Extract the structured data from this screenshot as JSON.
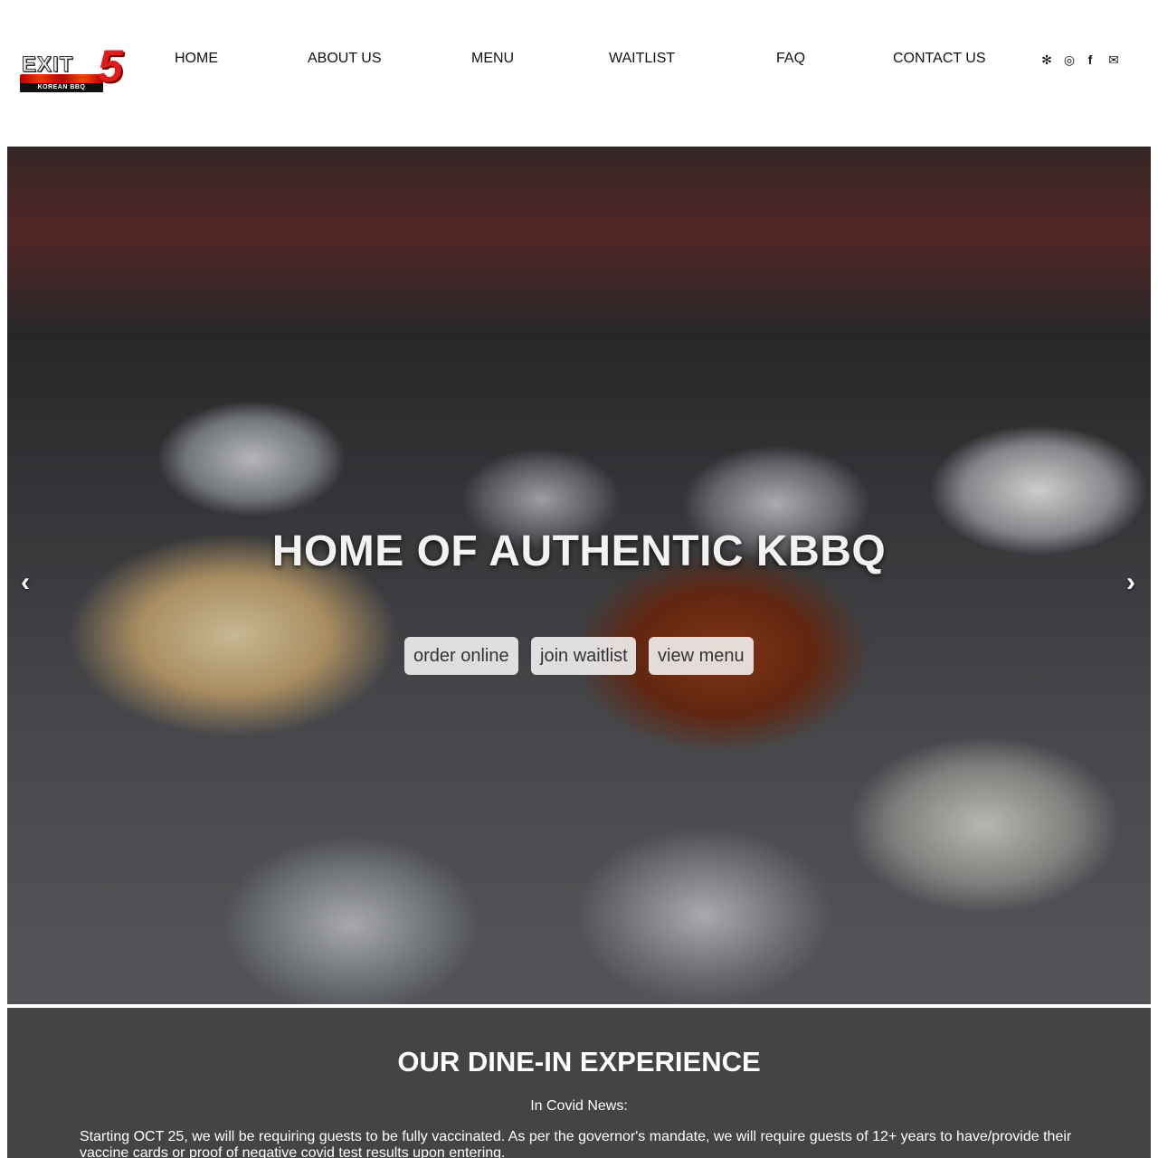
{
  "brand": {
    "logo_word": "EXIT",
    "logo_number": "5",
    "logo_subtitle": "KOREAN BBQ"
  },
  "nav": {
    "items": [
      {
        "label": "HOME"
      },
      {
        "label": "ABOUT US"
      },
      {
        "label": "MENU"
      },
      {
        "label": "WAITLIST"
      },
      {
        "label": "FAQ"
      },
      {
        "label": "CONTACT US"
      }
    ]
  },
  "social": {
    "icons": [
      "yelp-icon",
      "instagram-icon",
      "facebook-icon",
      "email-icon"
    ],
    "glyphs": {
      "yelp": "✻",
      "instagram": "◎",
      "facebook": "f",
      "email": "✉"
    }
  },
  "hero": {
    "title": "HOME OF AUTHENTIC KBBQ",
    "buttons": {
      "order": "order online",
      "waitlist": "join waitlist",
      "menu": "view menu"
    },
    "prev_glyph": "‹",
    "next_glyph": "›"
  },
  "dine_in": {
    "title": "OUR DINE-IN EXPERIENCE",
    "subtitle": "In Covid News:",
    "body": "Starting OCT 25, we will be requiring guests to be fully vaccinated. As per the governor's mandate, we will require guests of 12+ years to have/provide their vaccine cards or proof of negative covid test results upon entering."
  },
  "colors": {
    "brand_red": "#e01b1b",
    "section_bg": "#444444",
    "text_dark": "#111111"
  }
}
